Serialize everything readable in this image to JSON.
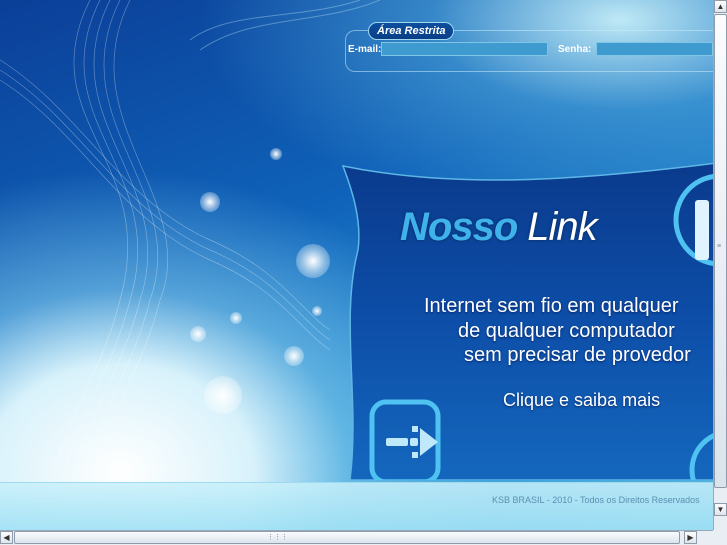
{
  "login": {
    "title": "Área Restrita",
    "email_label": "E-mail:",
    "email_value": "",
    "password_label": "Senha:",
    "password_value": ""
  },
  "banner": {
    "brand_part1": "Nosso",
    "brand_part2": "Link",
    "line1": "Internet sem fio em qualquer",
    "line2": "de qualquer computador",
    "line3": "sem precisar de provedor",
    "cta": "Clique e saiba mais"
  },
  "footer": {
    "text": "KSB BRASIL - 2010 - Todos os Direitos Reservados"
  },
  "colors": {
    "brand_blue": "#3fb2ec",
    "panel_dark": "#0a3a8c"
  },
  "icons": {
    "arrow": "arrow-right-icon",
    "pause": "pause-icon"
  }
}
